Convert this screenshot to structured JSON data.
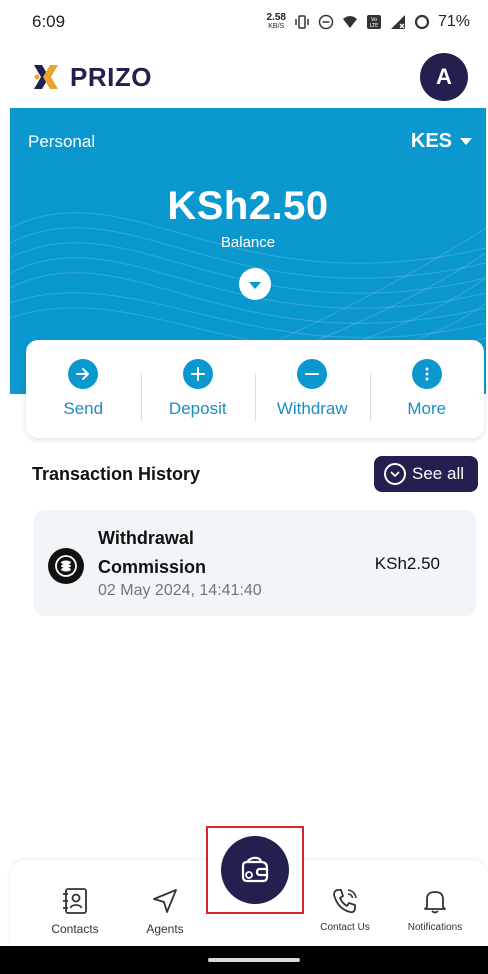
{
  "status_bar": {
    "time": "6:09",
    "net_speed": "2.58",
    "net_unit": "KB/S",
    "battery": "71%"
  },
  "header": {
    "brand": "PRIZO",
    "avatar_initial": "A",
    "colors": {
      "brand_navy": "#23204f",
      "brand_gold": "#e8a530"
    }
  },
  "balance": {
    "account_type": "Personal",
    "currency": "KES",
    "amount": "KSh2.50",
    "label": "Balance",
    "colors": {
      "card_bg": "#0a98cf"
    }
  },
  "actions": [
    {
      "label": "Send",
      "icon": "arrow-right-icon"
    },
    {
      "label": "Deposit",
      "icon": "plus-icon"
    },
    {
      "label": "Withdraw",
      "icon": "minus-icon"
    },
    {
      "label": "More",
      "icon": "more-vertical-icon"
    }
  ],
  "transactions": {
    "title": "Transaction History",
    "see_all_label": "See all",
    "items": [
      {
        "name": "Withdrawal Commission",
        "date": "02 May 2024, 14:41:40",
        "amount": "KSh2.50",
        "icon": "coins-icon"
      }
    ]
  },
  "bottom_nav": {
    "items": [
      {
        "label": "Contacts",
        "icon": "contacts-book-icon"
      },
      {
        "label": "Agents",
        "icon": "navigation-arrow-icon"
      },
      {
        "label": "Contact Us",
        "icon": "phone-call-icon"
      },
      {
        "label": "Notifications",
        "icon": "bell-icon"
      }
    ],
    "center_action_icon": "wallet-icon"
  }
}
